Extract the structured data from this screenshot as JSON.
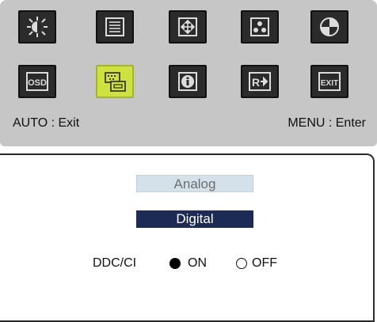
{
  "menu": {
    "icons_row1": [
      "brightness-icon",
      "picture-list-icon",
      "position-icon",
      "color-icon",
      "image-adjust-icon"
    ],
    "icons_row2": [
      "osd-icon",
      "input-select-icon",
      "info-icon",
      "reset-icon",
      "exit-icon"
    ],
    "active_icon": "input-select-icon",
    "osd_text": "OSD",
    "exit_text": "EXIT",
    "auto_hint": "AUTO : Exit",
    "menu_hint": "MENU : Enter"
  },
  "input": {
    "analog_label": "Analog",
    "digital_label": "Digital",
    "selected": "Digital"
  },
  "ddc": {
    "label": "DDC/CI",
    "on_label": "ON",
    "off_label": "OFF",
    "selected": "ON"
  },
  "colors": {
    "panel_bg": "#c6c6c6",
    "tile_bg": "#2b2b2b",
    "active_tile": "#cde23c",
    "selected_bg": "#1b2b55",
    "unselected_bg": "#d4e1ea"
  }
}
